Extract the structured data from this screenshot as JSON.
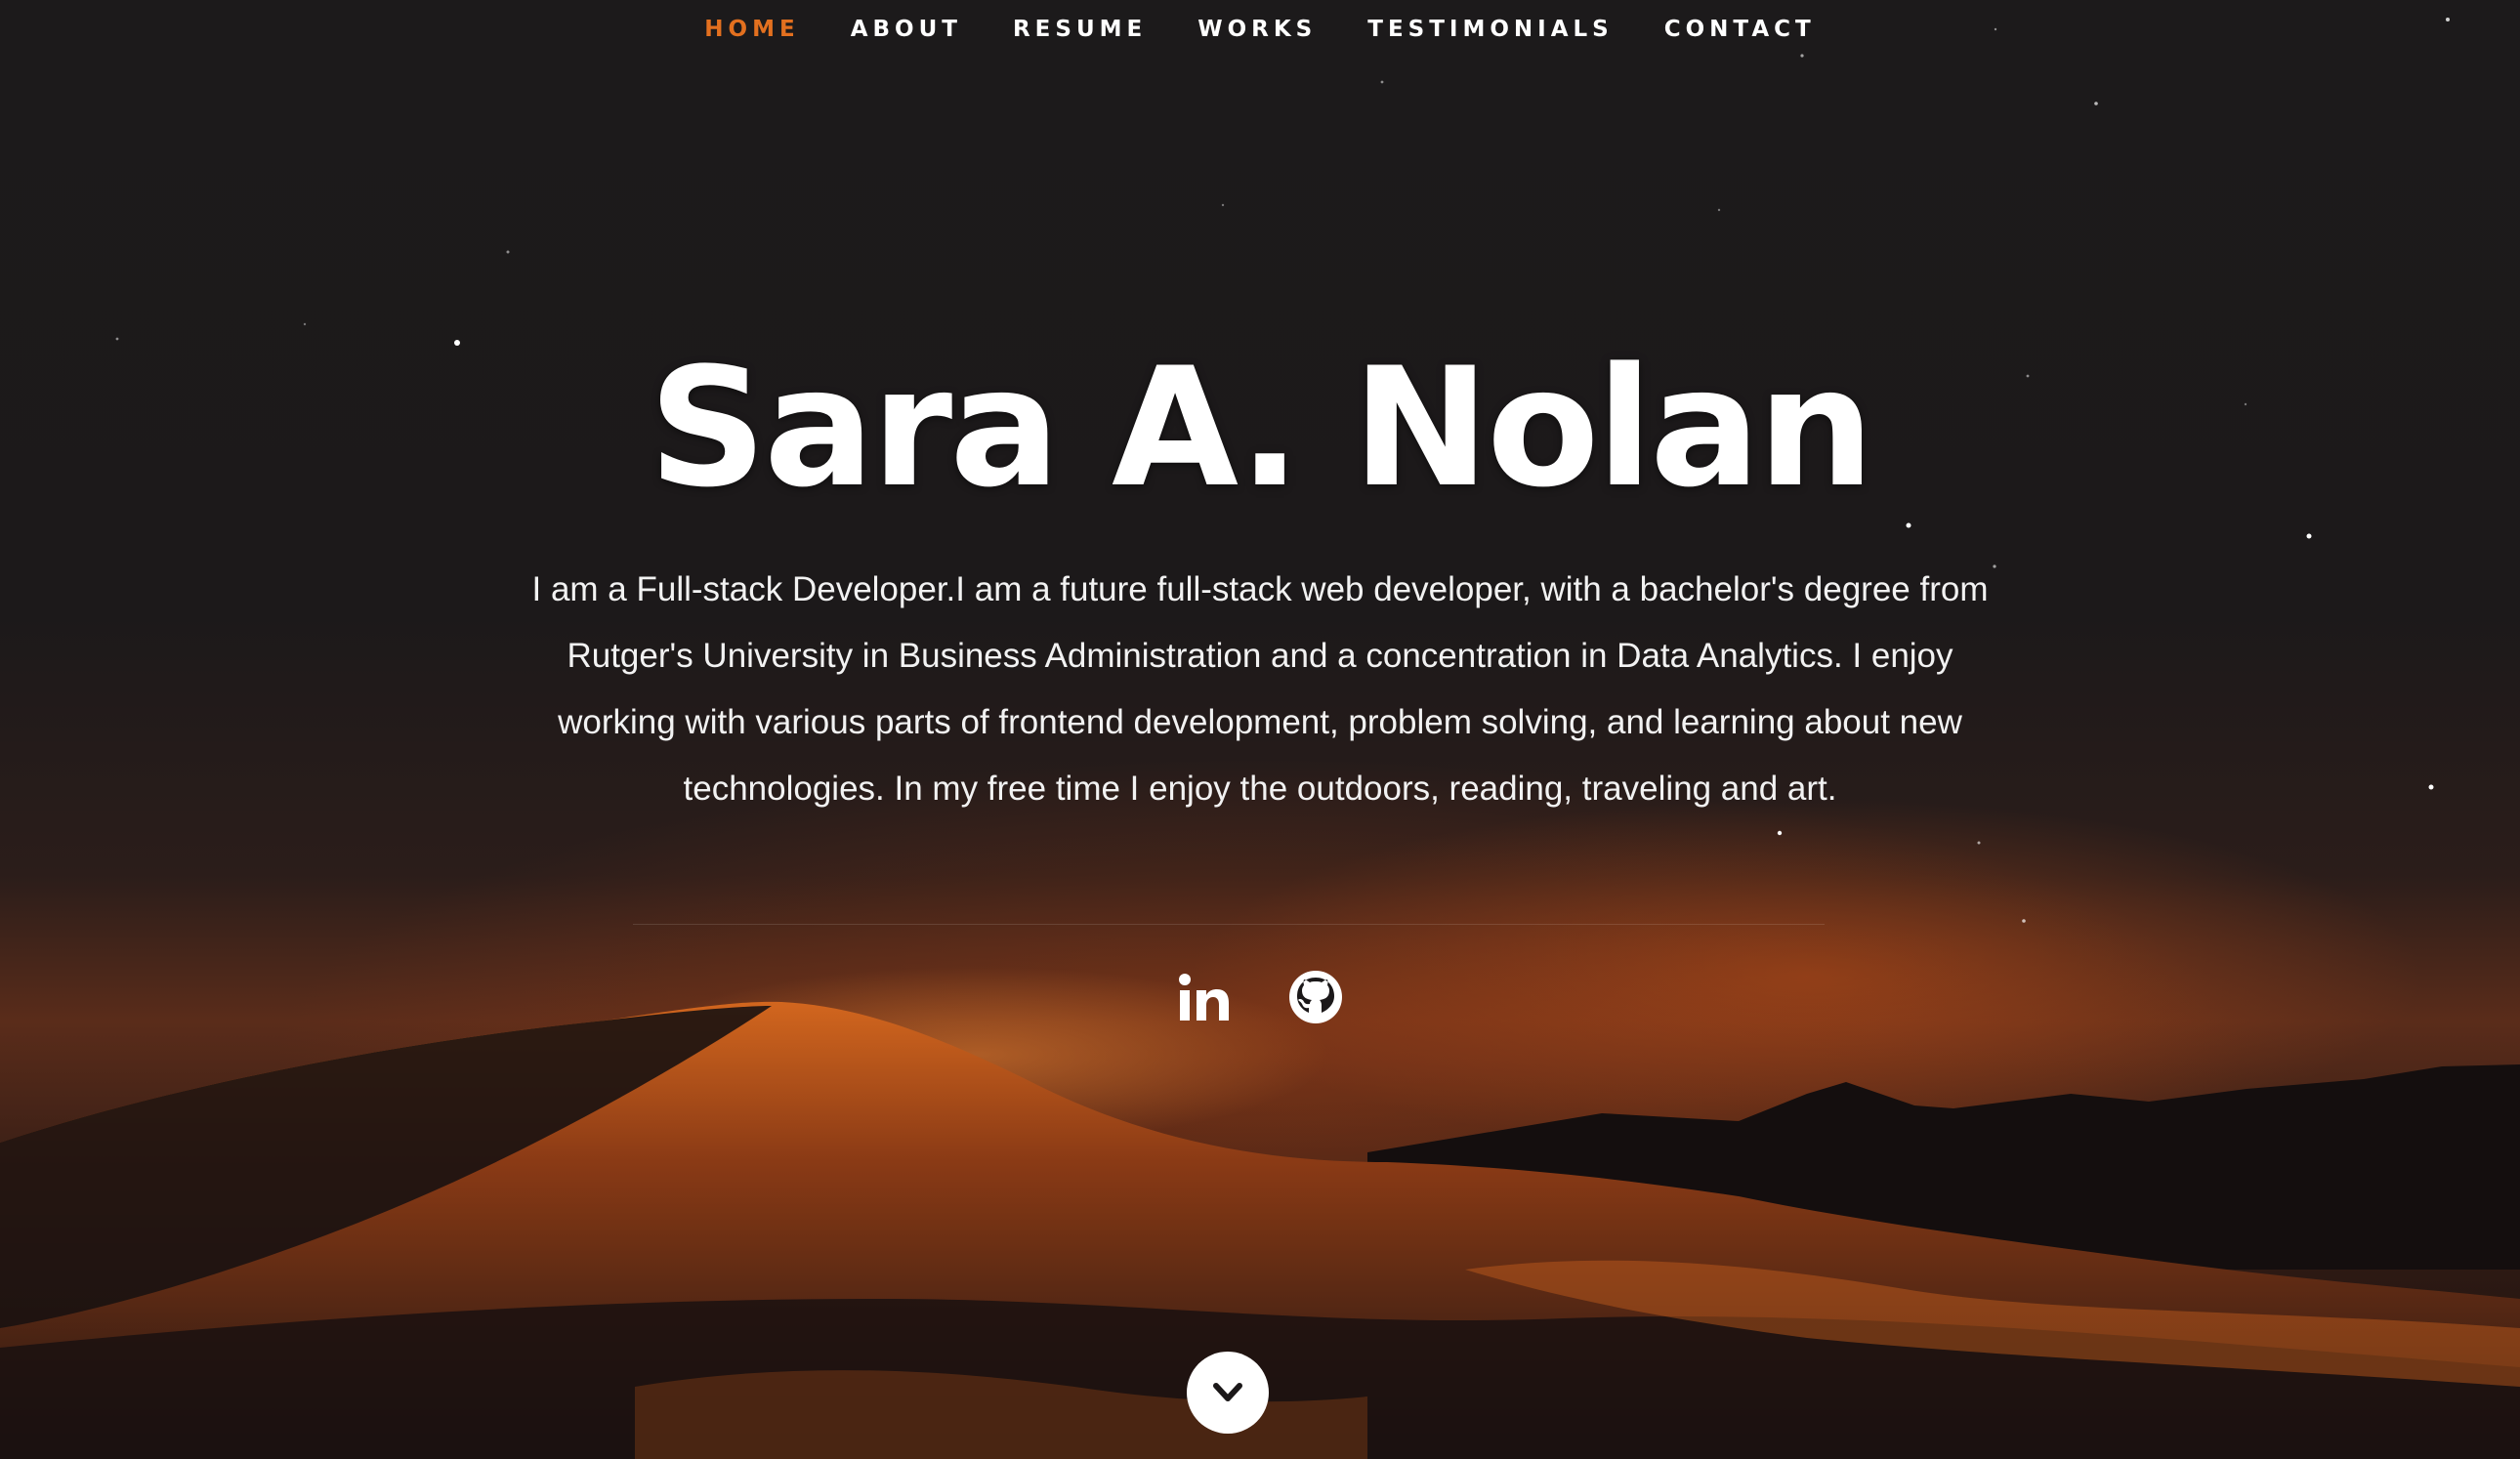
{
  "nav": {
    "items": [
      {
        "label": "HOME",
        "active": true
      },
      {
        "label": "ABOUT",
        "active": false
      },
      {
        "label": "RESUME",
        "active": false
      },
      {
        "label": "WORKS",
        "active": false
      },
      {
        "label": "TESTIMONIALS",
        "active": false
      },
      {
        "label": "CONTACT",
        "active": false
      }
    ],
    "active_color": "#e3701f"
  },
  "hero": {
    "name": "Sara A. Nolan",
    "bio": "I am a Full-stack Developer.I am a future full-stack web developer, with a bachelor's degree from Rutger's University in Business Administration and a concentration in Data Analytics. I enjoy working with various parts of frontend development, problem solving, and learning about new technologies. In my free time I enjoy the outdoors, reading, traveling and art."
  },
  "social": [
    {
      "name": "linkedin-icon"
    },
    {
      "name": "github-icon"
    }
  ],
  "scroll": {
    "icon": "chevron-down-icon"
  },
  "colors": {
    "accent": "#e3701f",
    "text": "#ffffff",
    "background": "#1b1819"
  }
}
